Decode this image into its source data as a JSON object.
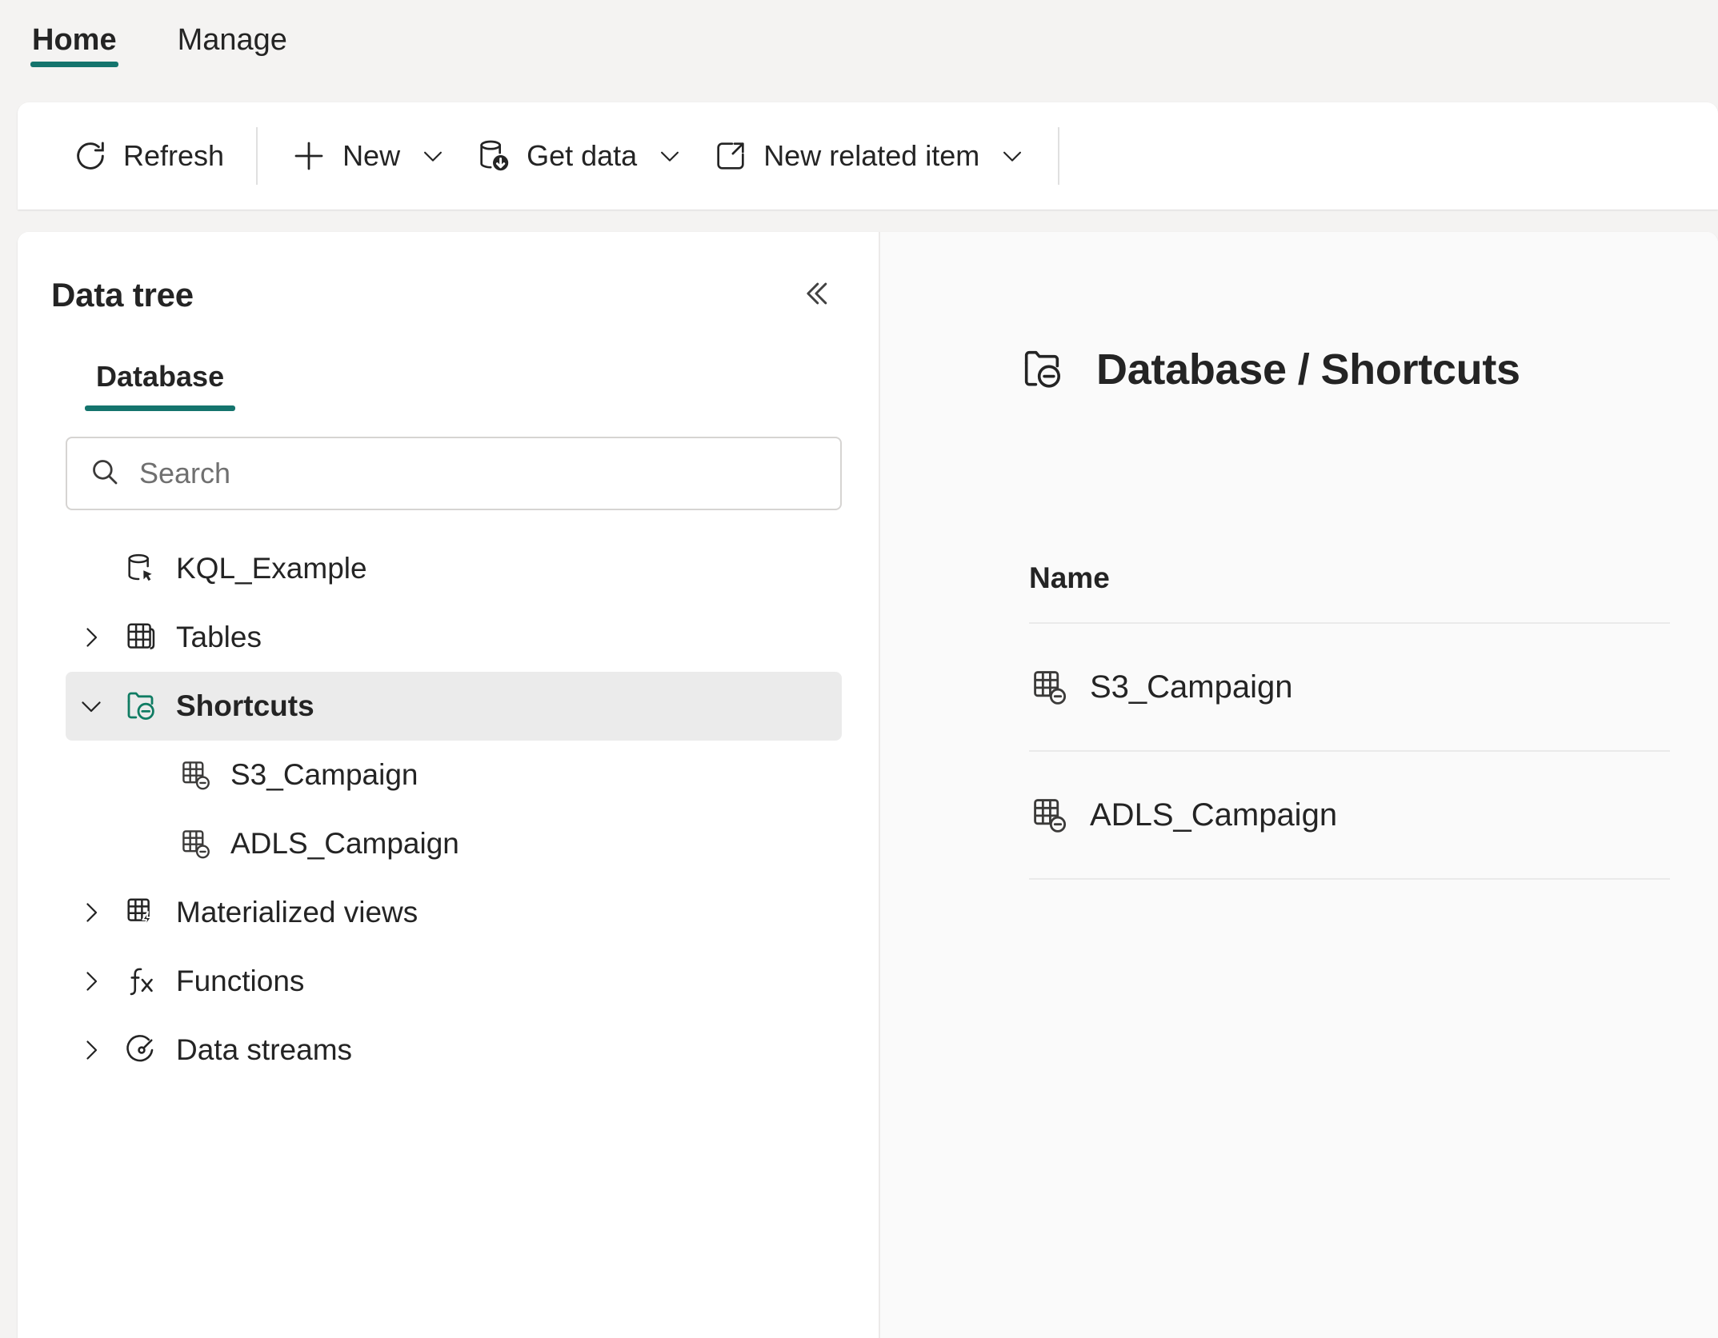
{
  "ribbon": {
    "tabs": [
      {
        "label": "Home",
        "active": true
      },
      {
        "label": "Manage",
        "active": false
      }
    ]
  },
  "commandbar": {
    "buttons": [
      {
        "label": "Refresh",
        "icon": "refresh-icon",
        "caret": false
      },
      {
        "label": "New",
        "icon": "plus-icon",
        "caret": true
      },
      {
        "label": "Get data",
        "icon": "get-data-icon",
        "caret": true
      },
      {
        "label": "New related item",
        "icon": "open-in-new-icon",
        "caret": true
      }
    ]
  },
  "tree_panel": {
    "title": "Data tree",
    "collapse_icon": "double-chevron-left-icon",
    "pivot_tabs": [
      {
        "label": "Database",
        "active": true
      }
    ],
    "search": {
      "placeholder": "Search",
      "value": "",
      "icon": "search-icon"
    },
    "nodes": [
      {
        "label": "KQL_Example",
        "icon": "database-icon",
        "twisty": "",
        "level": 0,
        "selected": false
      },
      {
        "label": "Tables",
        "icon": "table-icon",
        "twisty": "collapsed",
        "level": 1,
        "selected": false
      },
      {
        "label": "Shortcuts",
        "icon": "shortcut-folder-icon",
        "twisty": "expanded",
        "level": 1,
        "selected": true
      },
      {
        "label": "S3_Campaign",
        "icon": "table-shortcut-icon",
        "twisty": "",
        "level": 2,
        "selected": false
      },
      {
        "label": "ADLS_Campaign",
        "icon": "table-shortcut-icon",
        "twisty": "",
        "level": 2,
        "selected": false
      },
      {
        "label": "Materialized views",
        "icon": "materialized-view-icon",
        "twisty": "collapsed",
        "level": 1,
        "selected": false
      },
      {
        "label": "Functions",
        "icon": "function-icon",
        "twisty": "collapsed",
        "level": 1,
        "selected": false
      },
      {
        "label": "Data streams",
        "icon": "data-stream-icon",
        "twisty": "collapsed",
        "level": 1,
        "selected": false
      }
    ]
  },
  "detail_panel": {
    "icon": "shortcut-folder-icon",
    "breadcrumb_root": "Database",
    "breadcrumb_separator": "/",
    "breadcrumb_current": "Shortcuts",
    "table": {
      "columns": [
        "Name"
      ],
      "rows": [
        {
          "name": "S3_Campaign",
          "icon": "table-shortcut-icon"
        },
        {
          "name": "ADLS_Campaign",
          "icon": "table-shortcut-icon"
        }
      ]
    }
  },
  "colors": {
    "accent": "#14746d",
    "shortcut_green": "#107c63",
    "text": "#242424",
    "panel_bg": "#ffffff",
    "detail_bg": "#fafafa",
    "app_bg": "#f4f3f2",
    "selected_row": "#ebebeb",
    "divider": "#eaeaea"
  }
}
